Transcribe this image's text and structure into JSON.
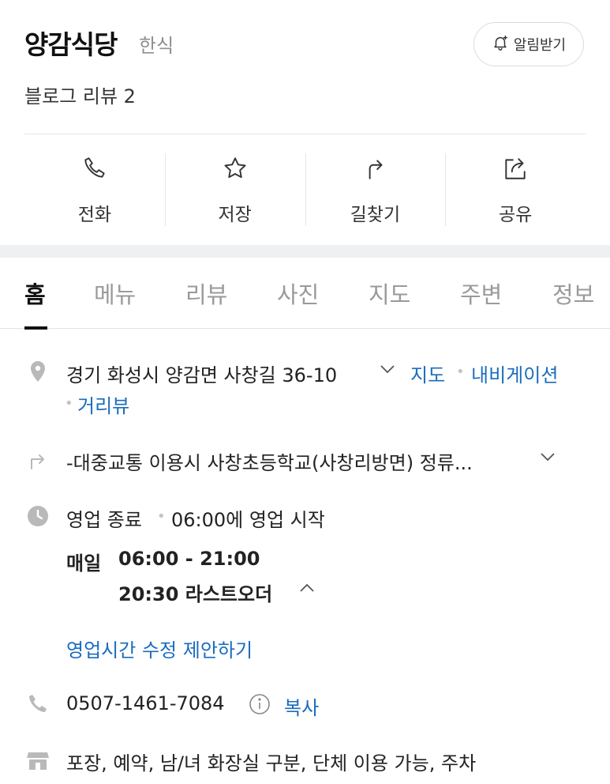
{
  "place": {
    "name": "양감식당",
    "category": "한식",
    "alarm_label": "알림받기",
    "review_text": "블로그 리뷰 2"
  },
  "actions": [
    {
      "label": "전화",
      "icon": "phone-icon"
    },
    {
      "label": "저장",
      "icon": "star-icon"
    },
    {
      "label": "길찾기",
      "icon": "directions-icon"
    },
    {
      "label": "공유",
      "icon": "share-icon"
    }
  ],
  "tabs": [
    "홈",
    "메뉴",
    "리뷰",
    "사진",
    "지도",
    "주변",
    "정보"
  ],
  "active_tab": "홈",
  "address": {
    "text": "경기 화성시 양감면 사창길 36-10",
    "links": [
      "지도",
      "내비게이션",
      "거리뷰"
    ]
  },
  "transit": {
    "text": "-대중교통 이용시 사창초등학교(사창리방면) 정류..."
  },
  "hours": {
    "status": "영업 종료",
    "next_open": "06:00에 영업 시작",
    "day": "매일",
    "time_range": "06:00 - 21:00",
    "last_order": "20:30 라스트오더",
    "edit_link": "영업시간 수정 제안하기"
  },
  "phone": {
    "number": "0507-1461-7084",
    "copy_label": "복사"
  },
  "amenities": {
    "text": "포장, 예약, 남/녀 화장실 구분, 단체 이용 가능, 주차"
  },
  "colors": {
    "link": "#1a6cbf",
    "icon_gray": "#b9b9b9",
    "band": "#eef0f2"
  }
}
